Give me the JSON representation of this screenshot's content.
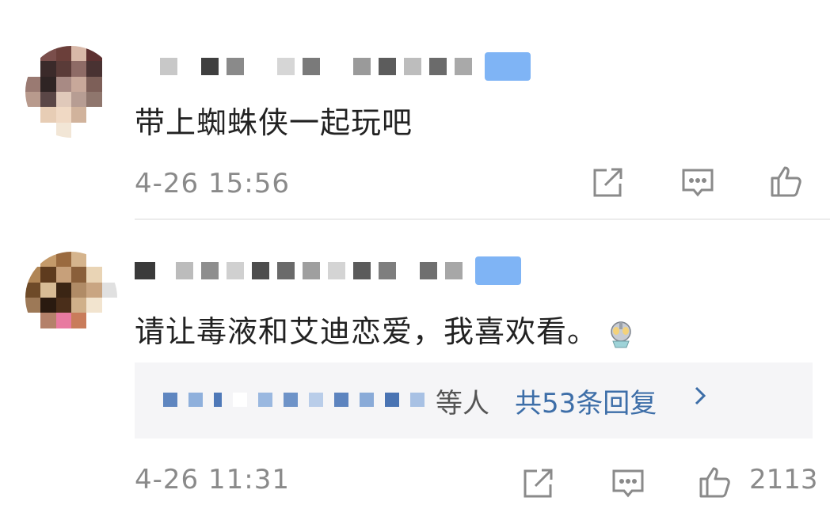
{
  "comments": [
    {
      "username": "",
      "text": "带上蜘蛛侠一起玩吧",
      "time": "4-26 15:56",
      "avatar_colors": [
        "#ffffff",
        "#7a4e4b",
        "#6b3f3a",
        "#d8b8a8",
        "#5d3030",
        "#ffffff",
        "#ffffff",
        "#3b2a2a",
        "#5a3b38",
        "#8e6b66",
        "#493232",
        "#ffffff",
        "#9a7a72",
        "#2f2424",
        "#a88a84",
        "#c8a89a",
        "#7d5f58",
        "#ffffff",
        "#b89a8d",
        "#5a4646",
        "#e0c9ba",
        "#b79d93",
        "#8f766d",
        "#ffffff",
        "#ffffff",
        "#e7cdb5",
        "#f0d9c4",
        "#d1b39c",
        "#ffffff",
        "#ffffff",
        "#ffffff",
        "#ffffff",
        "#f2e6d6",
        "#ffffff",
        "#ffffff",
        "#ffffff"
      ]
    },
    {
      "username": "",
      "text": "请让毒液和艾迪恋爱，我喜欢看。",
      "time": "4-26 11:31",
      "like_count": "2113",
      "reply_summary": "等人",
      "reply_link": "共53条回复",
      "avatar_colors": [
        "#ffffff",
        "#c49a6a",
        "#9a6a3f",
        "#d5b48d",
        "#ffffff",
        "#ffffff",
        "#b08555",
        "#5e3b1e",
        "#c7a07a",
        "#8a5f3a",
        "#e9d4b5",
        "#ffffff",
        "#6e4a28",
        "#d8bc96",
        "#3b2514",
        "#b08b66",
        "#c9a582",
        "#e0e0e0",
        "#9d7957",
        "#2a1a10",
        "#4a2e1a",
        "#d0b08a",
        "#f2e4cf",
        "#ffffff",
        "#ffffff",
        "#b4816a",
        "#e87aa0",
        "#c97c5b",
        "#ffffff",
        "#ffffff",
        "#ffffff",
        "#ffffff",
        "#ffffff",
        "#ffffff",
        "#ffffff",
        "#ffffff"
      ]
    }
  ],
  "colors": {
    "text": "#222222",
    "time": "#8a8a8a",
    "link": "#3d6ea8",
    "badge": "#7fb4f5",
    "reply_bg": "#f5f5f7"
  },
  "icons": [
    "share-icon",
    "comment-icon",
    "like-icon",
    "chevron-right-icon",
    "ultraman-emoji"
  ]
}
